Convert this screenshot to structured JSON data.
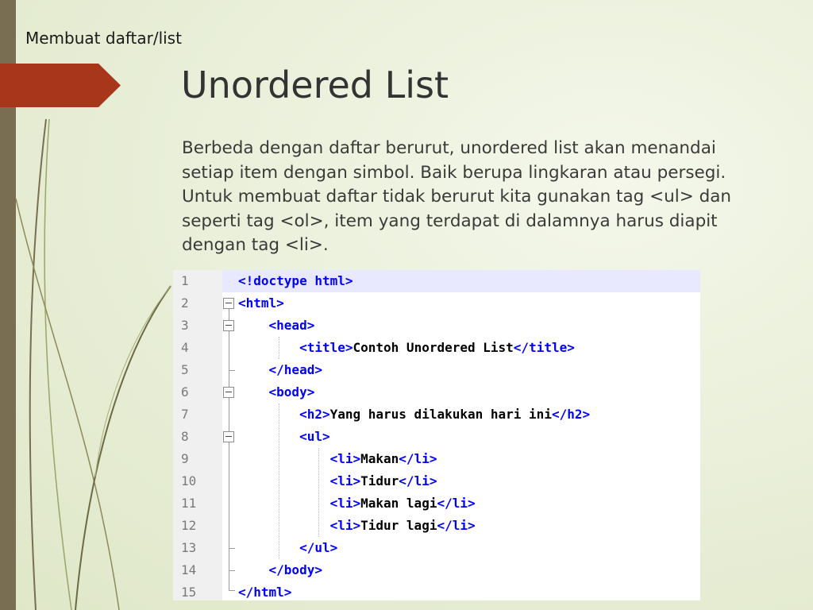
{
  "slide": {
    "section": "Membuat daftar/list",
    "title": "Unordered List",
    "paragraph": "Berbeda dengan daftar berurut, unordered list akan menandai setiap item dengan simbol. Baik berupa lingkaran atau persegi. Untuk membuat daftar tidak berurut kita gunakan tag <ul> dan seperti tag <ol>, item yang terdapat di dalamnya harus diapit dengan tag <li>."
  },
  "colors": {
    "accent_arrow": "#a8361b",
    "left_bar": "#7a6e52",
    "tag_color": "#0000ff",
    "text_color": "#000000"
  },
  "code": {
    "lines": [
      {
        "num": "1",
        "tag": "<!doctype html>",
        "text": "",
        "close": ""
      },
      {
        "num": "2",
        "tag": "<html>",
        "text": "",
        "close": ""
      },
      {
        "num": "3",
        "tag": "    <head>",
        "text": "",
        "close": ""
      },
      {
        "num": "4",
        "tag": "        <title>",
        "text": "Contoh Unordered List",
        "close": "</title>"
      },
      {
        "num": "5",
        "tag": "    </head>",
        "text": "",
        "close": ""
      },
      {
        "num": "6",
        "tag": "    <body>",
        "text": "",
        "close": ""
      },
      {
        "num": "7",
        "tag": "        <h2>",
        "text": "Yang harus dilakukan hari ini",
        "close": "</h2>"
      },
      {
        "num": "8",
        "tag": "        <ul>",
        "text": "",
        "close": ""
      },
      {
        "num": "9",
        "tag": "            <li>",
        "text": "Makan",
        "close": "</li>"
      },
      {
        "num": "10",
        "tag": "            <li>",
        "text": "Tidur",
        "close": "</li>"
      },
      {
        "num": "11",
        "tag": "            <li>",
        "text": "Makan lagi",
        "close": "</li>"
      },
      {
        "num": "12",
        "tag": "            <li>",
        "text": "Tidur lagi",
        "close": "</li>"
      },
      {
        "num": "13",
        "tag": "        </ul>",
        "text": "",
        "close": ""
      },
      {
        "num": "14",
        "tag": "    </body>",
        "text": "",
        "close": ""
      },
      {
        "num": "15",
        "tag": "</html>",
        "text": "",
        "close": ""
      }
    ]
  }
}
